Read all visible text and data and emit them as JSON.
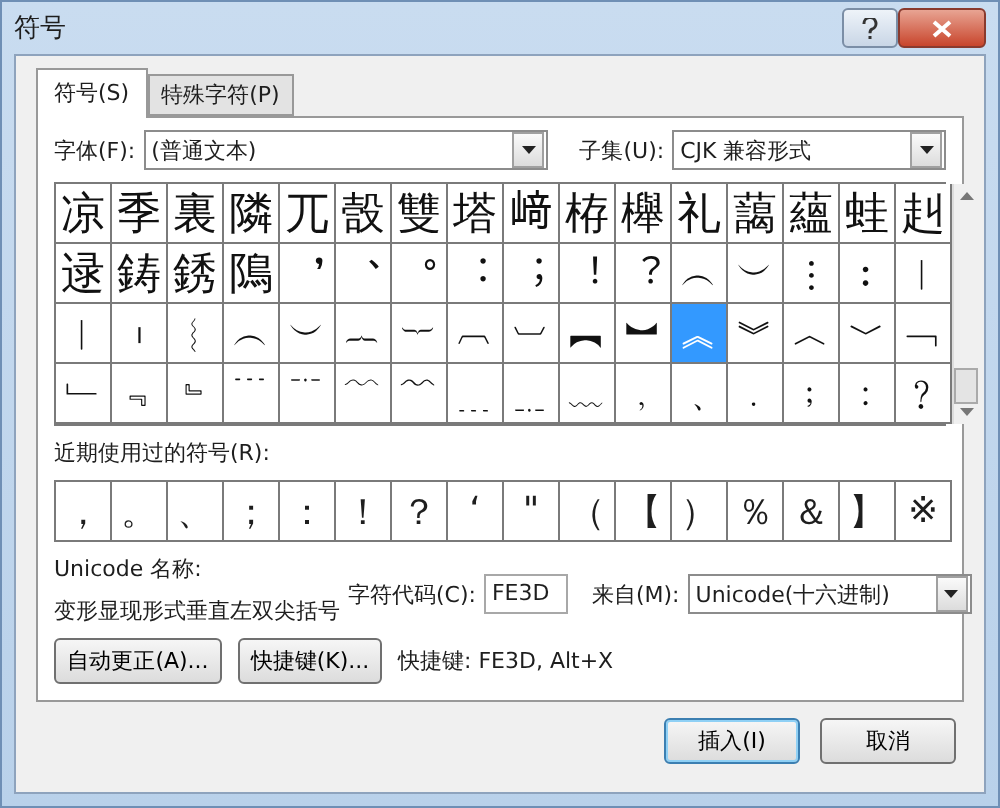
{
  "window": {
    "title": "符号"
  },
  "tabs": [
    {
      "label": "符号(S)",
      "selected": true
    },
    {
      "label": "特殊字符(P)",
      "selected": false
    }
  ],
  "font": {
    "label": "字体(F):",
    "value": "(普通文本)"
  },
  "subset": {
    "label": "子集(U):",
    "value": "CJK 兼容形式"
  },
  "symbol_rows": [
    {
      "cells": [
        {
          "char": "凉",
          "selected": false
        },
        {
          "char": "季",
          "selected": false
        },
        {
          "char": "裏",
          "selected": false
        },
        {
          "char": "隣",
          "selected": false
        },
        {
          "char": "兀",
          "selected": false
        },
        {
          "char": "嗀",
          "selected": false
        },
        {
          "char": "雙",
          "selected": false
        },
        {
          "char": "塔",
          "selected": false
        },
        {
          "char": "﨑",
          "selected": false
        },
        {
          "char": "栫",
          "selected": false
        },
        {
          "char": "櫸",
          "selected": false
        },
        {
          "char": "礼",
          "selected": false
        },
        {
          "char": "藹",
          "selected": false
        },
        {
          "char": "蘊",
          "selected": false
        },
        {
          "char": "蛙",
          "selected": false
        },
        {
          "char": "赳",
          "selected": false
        }
      ]
    },
    {
      "cells": [
        {
          "char": "逯",
          "selected": false
        },
        {
          "char": "鋳",
          "selected": false
        },
        {
          "char": "銹",
          "selected": false
        },
        {
          "char": "隝",
          "selected": false
        },
        {
          "char": "︐",
          "selected": false
        },
        {
          "char": "︑",
          "selected": false
        },
        {
          "char": "︒",
          "selected": false
        },
        {
          "char": "︓",
          "selected": false
        },
        {
          "char": "︔",
          "selected": false
        },
        {
          "char": "︕",
          "selected": false
        },
        {
          "char": "︖",
          "selected": false
        },
        {
          "char": "︵",
          "selected": false
        },
        {
          "char": "︶",
          "selected": false
        },
        {
          "char": "︙",
          "selected": false
        },
        {
          "char": "︰",
          "selected": false
        },
        {
          "char": "︱",
          "selected": false
        }
      ]
    },
    {
      "cells": [
        {
          "char": "︱",
          "selected": false
        },
        {
          "char": "︲",
          "selected": false
        },
        {
          "char": "︴",
          "selected": false
        },
        {
          "char": "︵",
          "selected": false
        },
        {
          "char": "︶",
          "selected": false
        },
        {
          "char": "︷",
          "selected": false
        },
        {
          "char": "︸",
          "selected": false
        },
        {
          "char": "︹",
          "selected": false
        },
        {
          "char": "︺",
          "selected": false
        },
        {
          "char": "︻",
          "selected": false
        },
        {
          "char": "︼",
          "selected": false
        },
        {
          "char": "︽",
          "selected": true
        },
        {
          "char": "︾",
          "selected": false
        },
        {
          "char": "︿",
          "selected": false
        },
        {
          "char": "﹀",
          "selected": false
        },
        {
          "char": "﹁",
          "selected": false
        }
      ]
    },
    {
      "cells": [
        {
          "char": "﹂",
          "selected": false
        },
        {
          "char": "﹃",
          "selected": false
        },
        {
          "char": "﹄",
          "selected": false
        },
        {
          "char": "﹉",
          "selected": false
        },
        {
          "char": "﹊",
          "selected": false
        },
        {
          "char": "﹋",
          "selected": false
        },
        {
          "char": "﹌",
          "selected": false
        },
        {
          "char": "﹍",
          "selected": false
        },
        {
          "char": "﹎",
          "selected": false
        },
        {
          "char": "﹏",
          "selected": false
        },
        {
          "char": "﹐",
          "selected": false
        },
        {
          "char": "﹑",
          "selected": false
        },
        {
          "char": "﹒",
          "selected": false
        },
        {
          "char": "﹔",
          "selected": false
        },
        {
          "char": "﹕",
          "selected": false
        },
        {
          "char": "﹖",
          "selected": false
        }
      ]
    }
  ],
  "recent": {
    "label": "近期使用过的符号(R):",
    "symbols": [
      "，",
      "。",
      "、",
      "；",
      "：",
      "！",
      "？",
      "‘",
      "\"",
      "（",
      "【",
      "）",
      "％",
      "＆",
      "】",
      "※"
    ]
  },
  "unicode_name": {
    "label": "Unicode 名称:",
    "value": "变形显现形式垂直左双尖括号"
  },
  "char_code": {
    "label": "字符代码(C):",
    "value": "FE3D"
  },
  "from": {
    "label": "来自(M):",
    "value": "Unicode(十六进制)"
  },
  "autocorrect_button": "自动更正(A)...",
  "shortcut_button": "快捷键(K)...",
  "shortcut_text": "快捷键: FE3D, Alt+X",
  "insert_button": "插入(I)",
  "cancel_button": "取消"
}
